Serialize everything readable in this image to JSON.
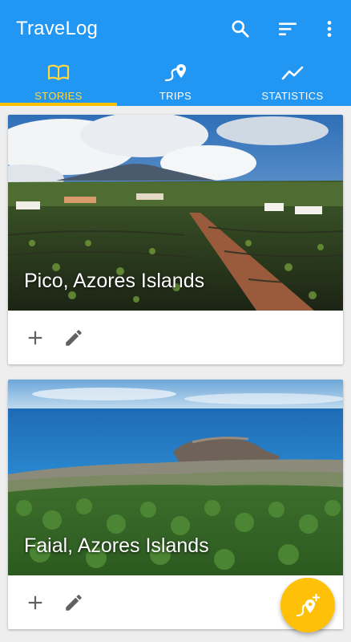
{
  "app": {
    "title": "TraveLog",
    "accent": "#2196f3",
    "highlight": "#ffc107"
  },
  "toolbar": {
    "icons": [
      "search-icon",
      "sort-icon",
      "more-vert-icon"
    ]
  },
  "tabs": [
    {
      "label": "STORIES",
      "icon": "book-open-icon",
      "active": true
    },
    {
      "label": "TRIPS",
      "icon": "route-pin-icon",
      "active": false
    },
    {
      "label": "STATISTICS",
      "icon": "trend-line-icon",
      "active": false
    }
  ],
  "stories": [
    {
      "title": "Pico, Azores Islands",
      "icons": [
        "add-icon",
        "edit-icon"
      ]
    },
    {
      "title": "Faial, Azores Islands",
      "icons": [
        "add-icon",
        "edit-icon"
      ]
    }
  ],
  "fab": {
    "icon": "add-location-icon"
  }
}
